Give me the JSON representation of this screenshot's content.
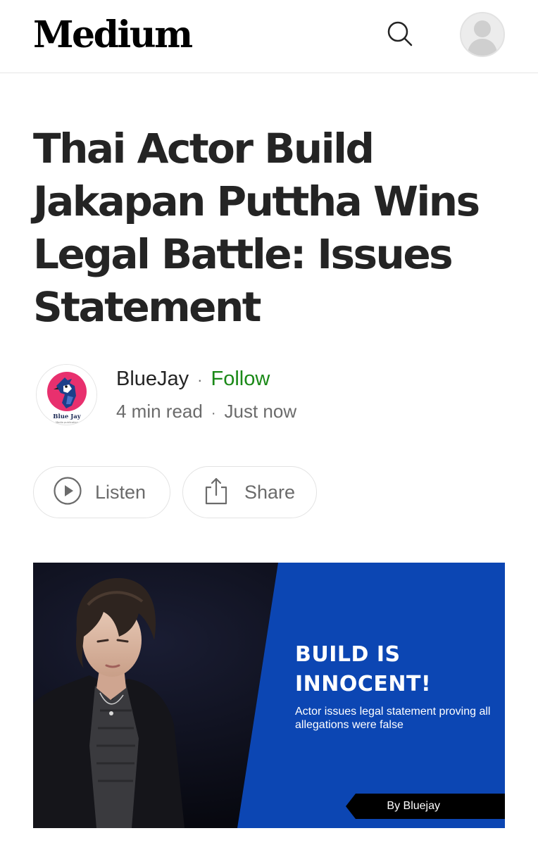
{
  "header": {
    "logo": "Medium",
    "search_icon": "search-icon",
    "avatar_icon": "user-avatar-icon"
  },
  "article": {
    "title": "Thai Actor Build Jakapan Puttha Wins Legal Battle: Issues Statement",
    "author": {
      "name": "BlueJay",
      "follow_label": "Follow",
      "avatar_caption": "Blue Jay",
      "avatar_tagline": "Media publication"
    },
    "meta": {
      "read_time": "4 min read",
      "published": "Just now"
    },
    "actions": {
      "listen_label": "Listen",
      "share_label": "Share"
    },
    "hero": {
      "headline_line1": "BUILD IS",
      "headline_line2": "INNOCENT!",
      "subtext": "Actor issues legal statement proving all allegations were false",
      "byline": "By Bluejay",
      "colors": {
        "panel_blue": "#0c46b3",
        "background_dark": "#0b0c16",
        "byline_bar": "#000000"
      }
    }
  },
  "colors": {
    "text_primary": "#242424",
    "text_secondary": "#6b6b6b",
    "follow_green": "#1a8917",
    "border": "#e6e6e6"
  }
}
